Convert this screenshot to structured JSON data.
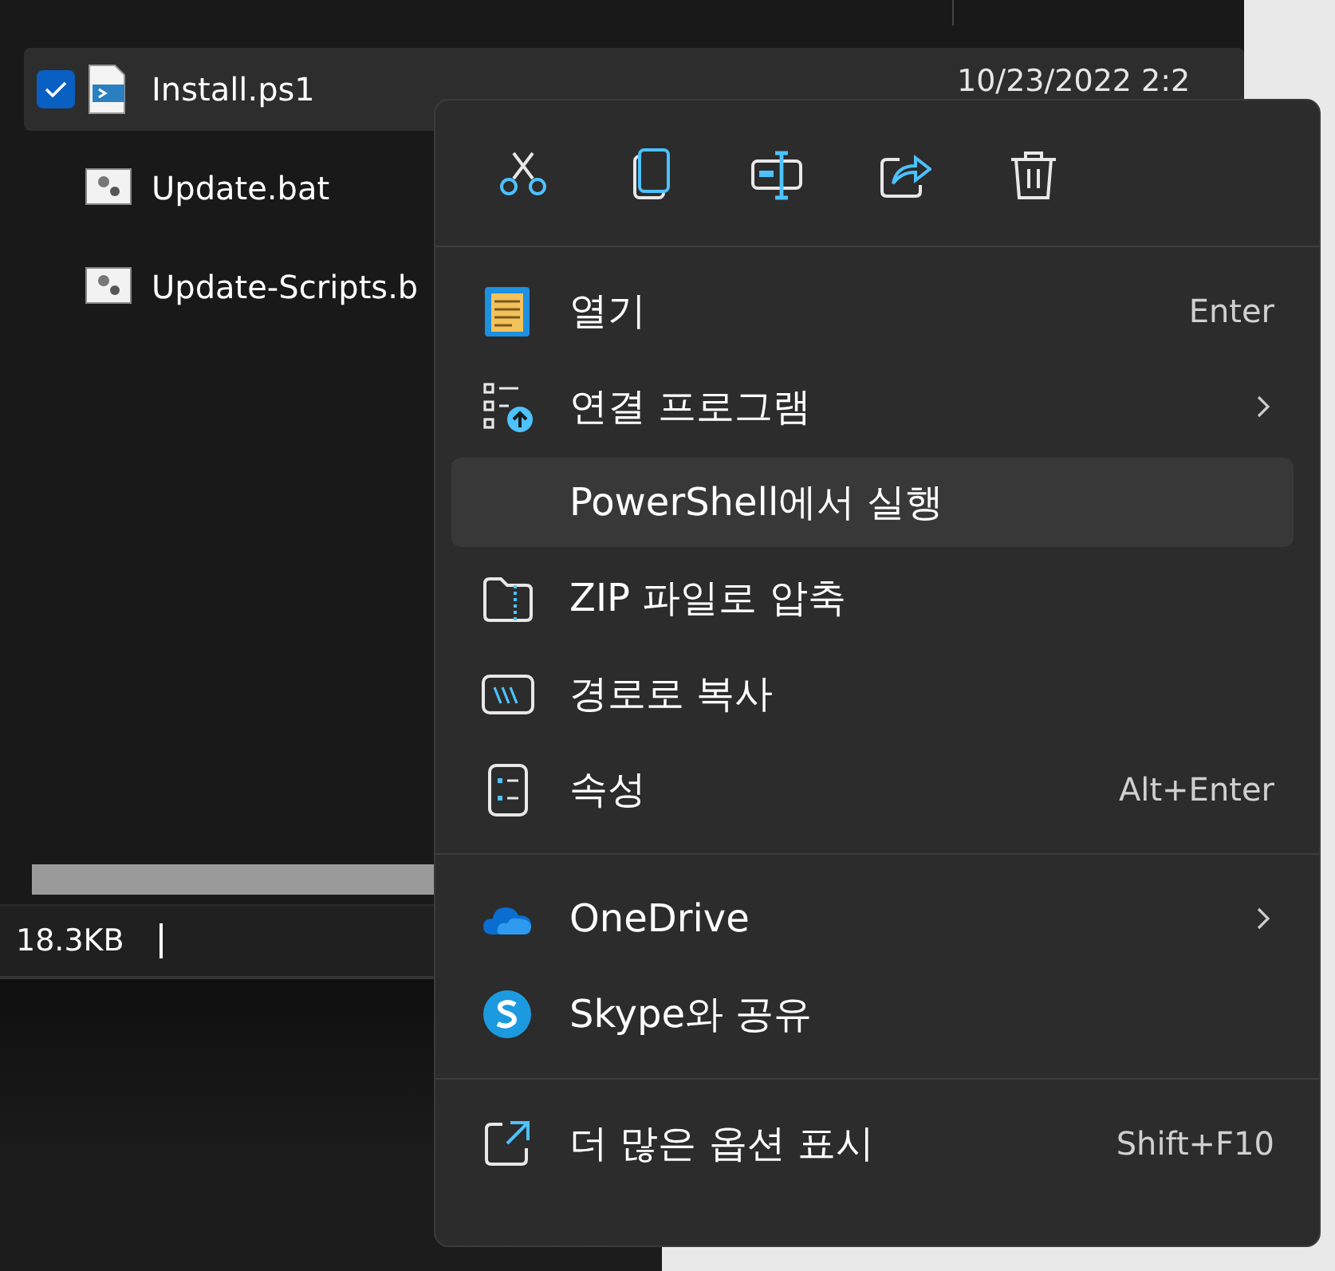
{
  "file_list": {
    "rows": [
      {
        "name": "Install.ps1",
        "date": "10/23/2022 2:2",
        "checked": true,
        "selected": true,
        "kind": "script"
      },
      {
        "name": "Update.bat",
        "checked": false,
        "selected": false,
        "kind": "batch"
      },
      {
        "name": "Update-Scripts.b",
        "checked": false,
        "selected": false,
        "kind": "batch"
      }
    ]
  },
  "status_bar": {
    "size": "18.3KB"
  },
  "context_menu": {
    "toolbar": [
      {
        "kind": "cut"
      },
      {
        "kind": "copy"
      },
      {
        "kind": "rename"
      },
      {
        "kind": "share"
      },
      {
        "kind": "delete"
      }
    ],
    "sections": [
      [
        {
          "label": "열기",
          "shortcut": "Enter",
          "kind": "notepad",
          "submenu": false,
          "highlighted": false
        },
        {
          "label": "연결 프로그램",
          "kind": "open-with",
          "submenu": true,
          "highlighted": false
        },
        {
          "label": "PowerShell에서 실행",
          "submenu": false,
          "highlighted": true
        },
        {
          "label": "ZIP 파일로 압축",
          "kind": "zip",
          "submenu": false,
          "highlighted": false
        },
        {
          "label": "경로로 복사",
          "kind": "path",
          "submenu": false,
          "highlighted": false
        },
        {
          "label": "속성",
          "shortcut": "Alt+Enter",
          "kind": "properties",
          "submenu": false,
          "highlighted": false
        }
      ],
      [
        {
          "label": "OneDrive",
          "kind": "cloud",
          "submenu": true,
          "highlighted": false
        },
        {
          "label": "Skype와 공유",
          "kind": "skype",
          "submenu": false,
          "highlighted": false
        }
      ],
      [
        {
          "label": "더 많은 옵션 표시",
          "shortcut": "Shift+F10",
          "kind": "more",
          "submenu": false,
          "highlighted": false
        }
      ]
    ]
  }
}
